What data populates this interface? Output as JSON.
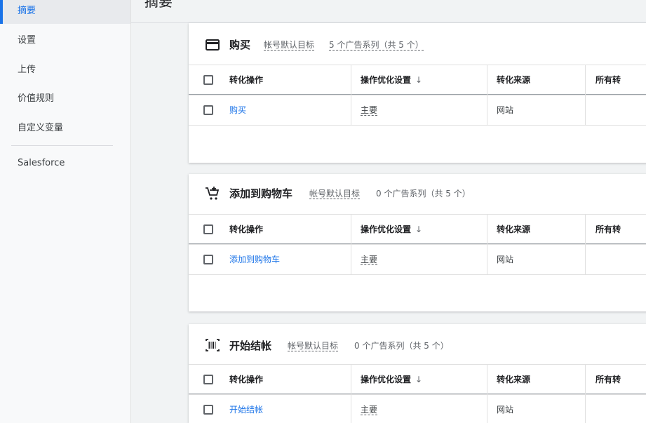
{
  "sidebar": {
    "items": [
      {
        "label": "摘要",
        "active": true
      },
      {
        "label": "设置"
      },
      {
        "label": "上传"
      },
      {
        "label": "价值规则"
      },
      {
        "label": "自定义变量"
      },
      {
        "label": "Salesforce"
      }
    ]
  },
  "page": {
    "title": "摘要"
  },
  "columns": [
    "转化操作",
    "操作优化设置",
    "转化来源",
    "所有转"
  ],
  "sort_arrow": "↓",
  "cards": [
    {
      "icon": "credit-card-icon",
      "title": "购买",
      "goal_label": "帐号默认目标",
      "campaigns": "5 个广告系列（共 5 个）",
      "row": {
        "action": "购买",
        "optimization": "主要",
        "source": "网站"
      }
    },
    {
      "icon": "add-to-cart-icon",
      "title": "添加到购物车",
      "goal_label": "帐号默认目标",
      "campaigns": "0 个广告系列（共 5 个）",
      "row": {
        "action": "添加到购物车",
        "optimization": "主要",
        "source": "网站"
      }
    },
    {
      "icon": "barcode-icon",
      "title": "开始结帐",
      "goal_label": "帐号默认目标",
      "campaigns": "0 个广告系列（共 5 个）",
      "row": {
        "action": "开始结帐",
        "optimization": "主要",
        "source": "网站"
      }
    }
  ],
  "colors": {
    "accent": "#1a73e8",
    "text": "#3c4043"
  }
}
